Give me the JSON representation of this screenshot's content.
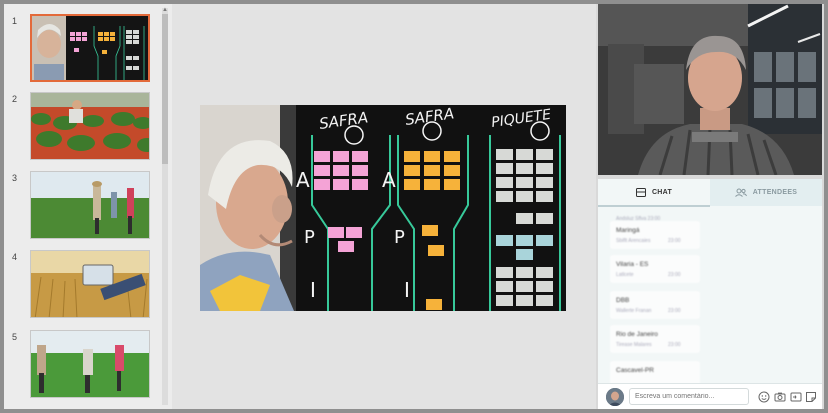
{
  "slides": {
    "numbers": [
      "1",
      "2",
      "3",
      "4",
      "5"
    ],
    "active_index": 0
  },
  "board": {
    "headings": [
      "SAFRA",
      "SAFRA",
      "PIQUETE"
    ],
    "column_letters": [
      "A",
      "P",
      "I"
    ]
  },
  "panel": {
    "tabs": {
      "chat": "CHAT",
      "attendees": "ATTENDEES"
    },
    "messages": [
      {
        "name": "Maringá",
        "sub": "Sbiflt Arencaies",
        "time": "23:00"
      },
      {
        "name": "Vilaria - ES",
        "sub": "Latlcete",
        "time": "23:00"
      },
      {
        "name": "DBB",
        "sub": "Wallerte Franan",
        "time": "23:00"
      },
      {
        "name": "Rio de Janeiro",
        "sub": "Tirease Malares",
        "time": "23:00"
      },
      {
        "name": "Cascavel-PR",
        "sub": "",
        "time": ""
      }
    ],
    "top_partial": "Andsluz Sflva   23:00",
    "compose_placeholder": "Escreva um comentário..."
  },
  "colors": {
    "accent": "#e36a3a",
    "note_pink": "#f4a3d6",
    "note_orange": "#f6b23a",
    "note_grey": "#d7d9d6",
    "note_blue": "#a9d4da",
    "board_line": "#37c99a"
  }
}
